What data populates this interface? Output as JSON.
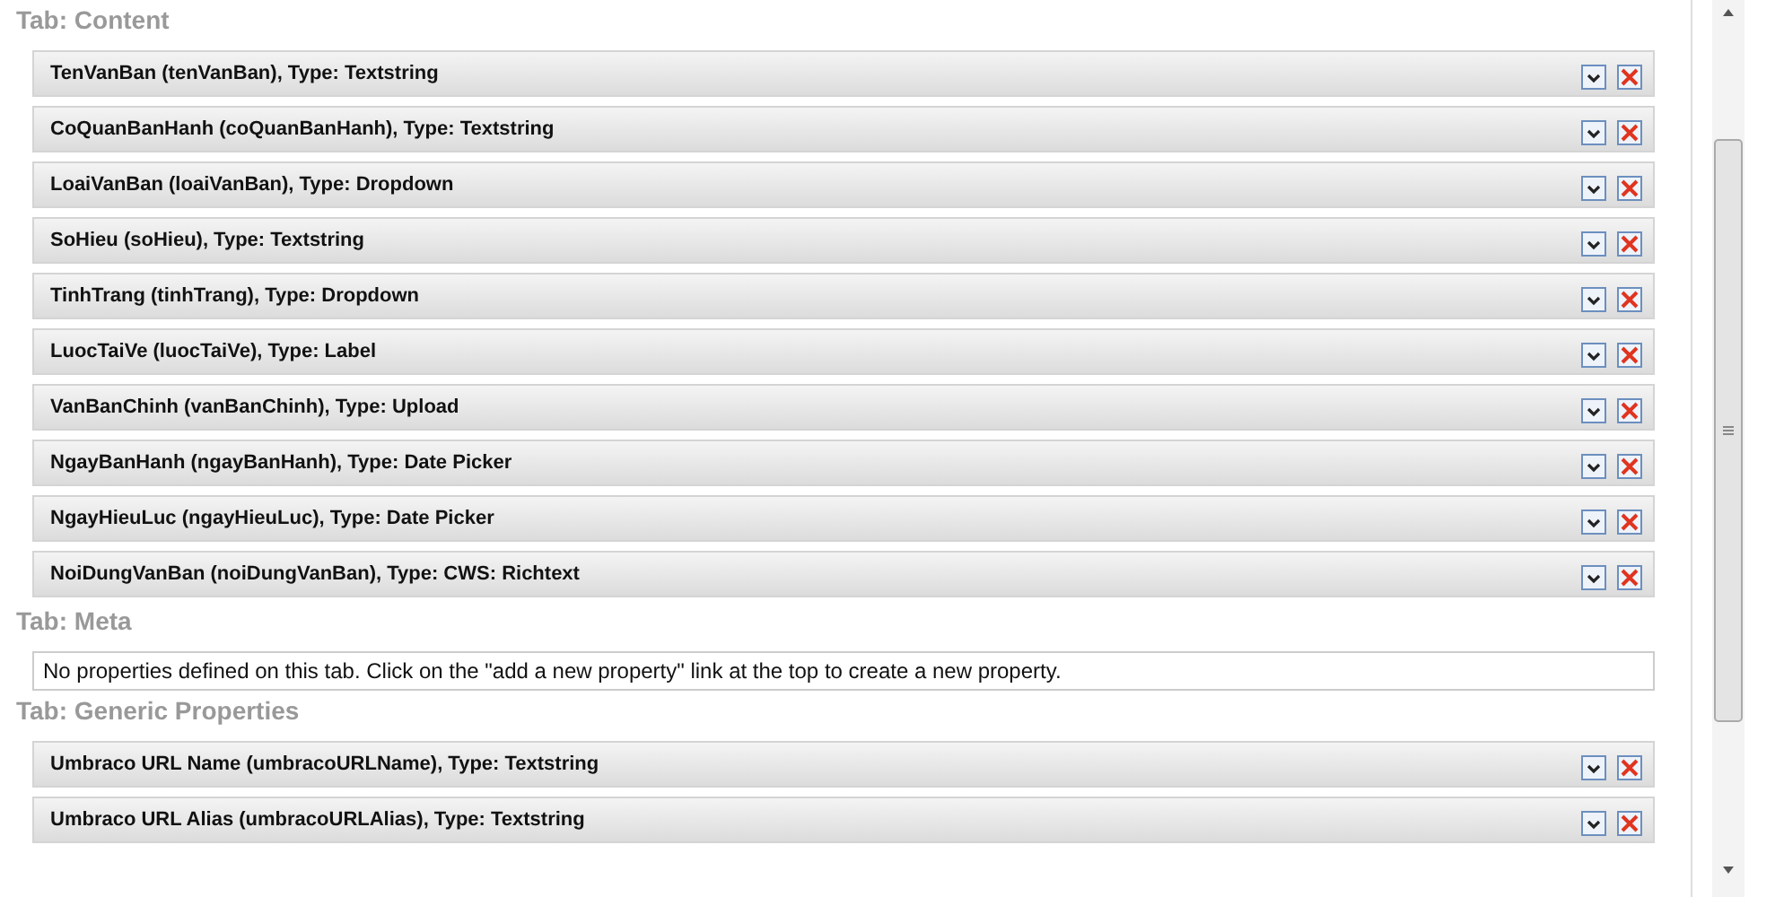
{
  "sections": [
    {
      "title": "Tab: Content",
      "kind": "properties",
      "properties": [
        {
          "label": "TenVanBan (tenVanBan), Type: Textstring"
        },
        {
          "label": "CoQuanBanHanh (coQuanBanHanh), Type: Textstring"
        },
        {
          "label": "LoaiVanBan (loaiVanBan), Type: Dropdown"
        },
        {
          "label": "SoHieu (soHieu), Type: Textstring"
        },
        {
          "label": "TinhTrang (tinhTrang), Type: Dropdown"
        },
        {
          "label": "LuocTaiVe (luocTaiVe), Type: Label"
        },
        {
          "label": "VanBanChinh (vanBanChinh), Type: Upload"
        },
        {
          "label": "NgayBanHanh (ngayBanHanh), Type: Date Picker"
        },
        {
          "label": "NgayHieuLuc (ngayHieuLuc), Type: Date Picker"
        },
        {
          "label": "NoiDungVanBan (noiDungVanBan), Type: CWS: Richtext"
        }
      ]
    },
    {
      "title": "Tab: Meta",
      "kind": "message",
      "message": "No properties defined on this tab. Click on the \"add a new property\" link at the top to create a new property."
    },
    {
      "title": "Tab: Generic Properties",
      "kind": "properties",
      "properties": [
        {
          "label": "Umbraco URL Name (umbracoURLName), Type: Textstring"
        },
        {
          "label": "Umbraco URL Alias (umbracoURLAlias), Type: Textstring"
        }
      ]
    }
  ]
}
